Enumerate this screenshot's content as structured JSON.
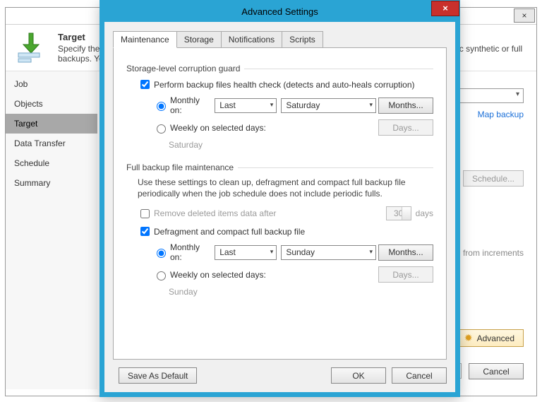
{
  "wizard": {
    "close_glyph": "×",
    "header_title": "Target",
    "header_desc_full": "Specify the target backup repository, number of recent restore points to keep, and whether to create periodic synthetic or full backups. You can use map backup functionality to seed backup files.",
    "nav": [
      "Job",
      "Objects",
      "Target",
      "Data Transfer",
      "Schedule",
      "Summary"
    ],
    "map_backup": "Map backup",
    "schedule_btn": "Schedule...",
    "increments_note": "from increments",
    "advanced_btn": "Advanced",
    "cancel_btn": "Cancel"
  },
  "dialog": {
    "title": "Advanced Settings",
    "close_glyph": "×",
    "tabs": [
      "Maintenance",
      "Storage",
      "Notifications",
      "Scripts"
    ],
    "section1": {
      "title": "Storage-level corruption guard",
      "check_label": "Perform backup files health check (detects and auto-heals corruption)",
      "monthly_label": "Monthly on:",
      "monthly_week": "Last",
      "monthly_day": "Saturday",
      "months_btn": "Months...",
      "weekly_label": "Weekly on selected days:",
      "days_btn": "Days...",
      "summary": "Saturday"
    },
    "section2": {
      "title": "Full backup file maintenance",
      "desc": "Use these settings to clean up, defragment and compact full backup file periodically when the job schedule does not include periodic fulls.",
      "remove_label": "Remove deleted items data after",
      "remove_value": "30",
      "remove_unit": "days",
      "defrag_label": "Defragment and compact full backup file",
      "monthly_label": "Monthly on:",
      "monthly_week": "Last",
      "monthly_day": "Sunday",
      "months_btn": "Months...",
      "weekly_label": "Weekly on selected days:",
      "days_btn": "Days...",
      "summary": "Sunday"
    },
    "save_default": "Save As Default",
    "ok": "OK",
    "cancel": "Cancel"
  }
}
